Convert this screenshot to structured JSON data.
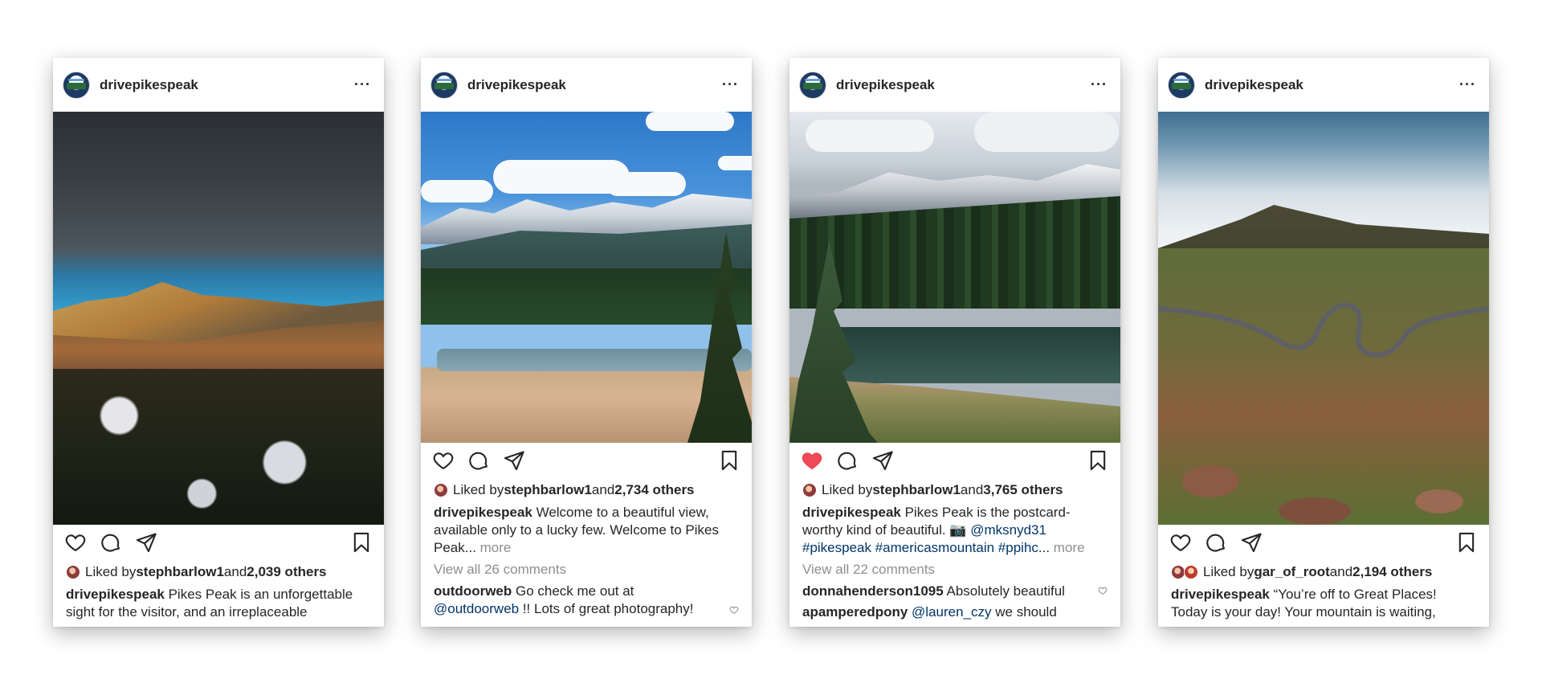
{
  "posts": [
    {
      "username": "drivepikespeak",
      "liked_by_prefix": "Liked by ",
      "liked_by_user": "stephbarlow1",
      "liked_by_and": " and ",
      "liked_by_others": "2,039 others",
      "caption_user": "drivepikespeak",
      "caption_text": " Pikes Peak is an unforgettable sight for the visitor, and an irreplaceable",
      "liked": false
    },
    {
      "username": "drivepikespeak",
      "liked_by_prefix": "Liked by ",
      "liked_by_user": "stephbarlow1",
      "liked_by_and": " and ",
      "liked_by_others": "2,734 others",
      "caption_user": "drivepikespeak",
      "caption_text": " Welcome to a beautiful view, available only to a lucky few. Welcome to Pikes Peak...",
      "more_label": " more",
      "view_comments": "View all 26 comments",
      "comment_user": "outdoorweb",
      "comment_text": " Go check me out at ",
      "comment_tag": "@outdoorweb",
      "comment_text2": " !! Lots of great photography!",
      "liked": false
    },
    {
      "username": "drivepikespeak",
      "liked_by_prefix": "Liked by ",
      "liked_by_user": "stephbarlow1",
      "liked_by_and": " and ",
      "liked_by_others": "3,765 others",
      "caption_user": "drivepikespeak",
      "caption_text": " Pikes Peak is the postcard-worthy kind of beautiful. 📷 ",
      "caption_tag1": "@mksnyd31",
      "caption_tags": "#pikespeak #americasmountain #ppihc...",
      "more_label": " more",
      "view_comments": "View all 22 comments",
      "comment_user": "donnahenderson1095",
      "comment_text": " Absolutely beautiful",
      "comment2_user": "apamperedpony",
      "comment2_tag": "@lauren_czy",
      "comment2_text": " we should",
      "liked": true
    },
    {
      "username": "drivepikespeak",
      "liked_by_prefix": "Liked by ",
      "liked_by_user": "gar_of_root",
      "liked_by_and": " and ",
      "liked_by_others": "2,194 others",
      "caption_user": "drivepikespeak",
      "caption_text": " “You’re off to Great Places! Today is your day! Your mountain is waiting,",
      "liked": false
    }
  ],
  "icons": {
    "more": "more-options-icon",
    "like": "heart-icon",
    "comment": "comment-icon",
    "share": "share-icon",
    "save": "bookmark-icon"
  },
  "colors": {
    "liked_heart": "#ed4956",
    "text": "#262626",
    "muted": "#8e8e8e",
    "tag": "#003569"
  }
}
